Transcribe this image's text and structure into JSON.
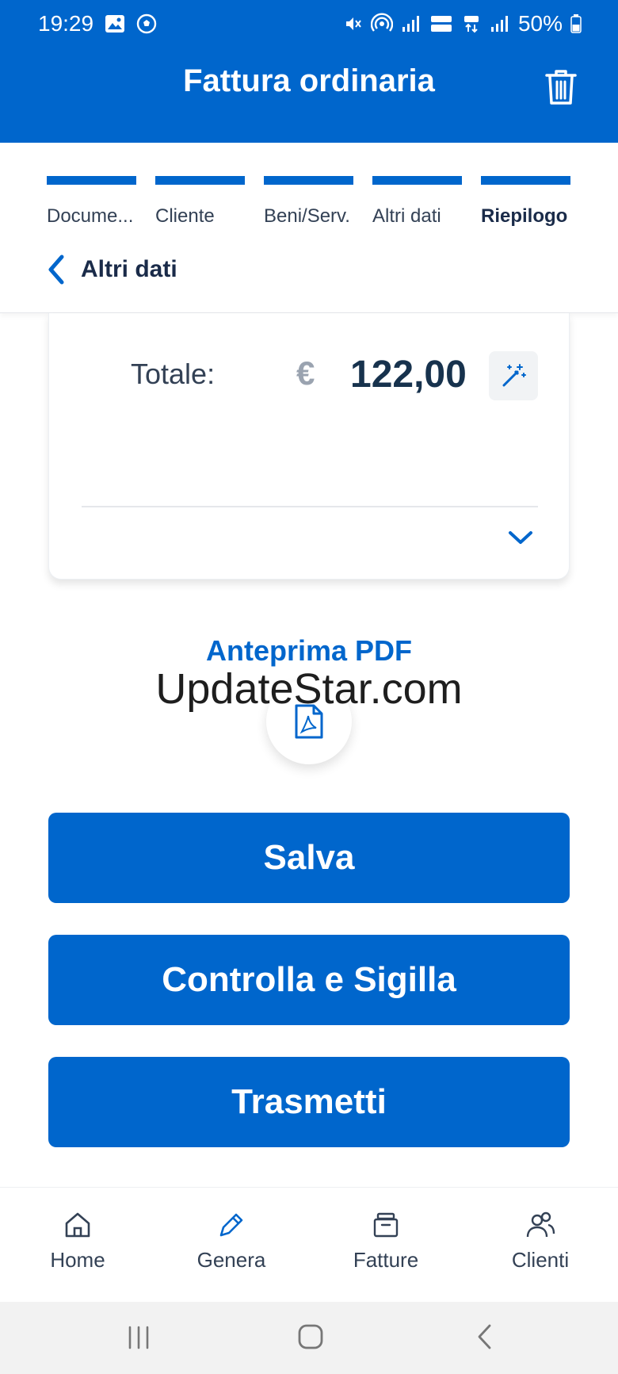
{
  "status_bar": {
    "time": "19:29",
    "battery": "50%"
  },
  "header": {
    "title": "Fattura ordinaria"
  },
  "steps": [
    {
      "label": "Docume..."
    },
    {
      "label": "Cliente"
    },
    {
      "label": "Beni/Serv."
    },
    {
      "label": "Altri dati"
    },
    {
      "label": "Riepilogo"
    }
  ],
  "back_nav": {
    "label": "Altri dati"
  },
  "summary": {
    "total_label": "Totale:",
    "currency": "€",
    "amount": "122,00"
  },
  "preview": {
    "title": "Anteprima PDF"
  },
  "watermark": "UpdateStar.com",
  "actions": {
    "save": "Salva",
    "check_seal": "Controlla e Sigilla",
    "transmit": "Trasmetti"
  },
  "bottom_nav": [
    {
      "label": "Home"
    },
    {
      "label": "Genera"
    },
    {
      "label": "Fatture"
    },
    {
      "label": "Clienti"
    }
  ],
  "colors": {
    "primary": "#0066cc",
    "text_dark": "#17324d"
  }
}
